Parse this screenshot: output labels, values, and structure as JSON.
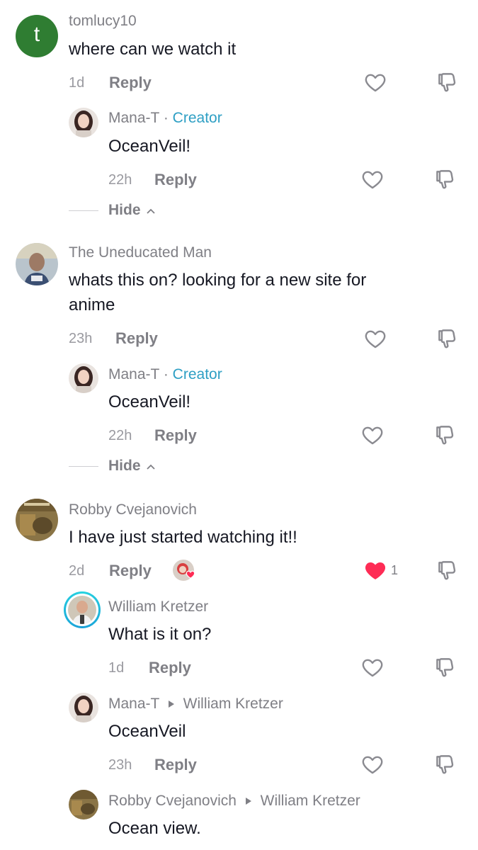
{
  "threads": [
    {
      "username": "tomlucy10",
      "avatar_letter": "t",
      "text": "where can we watch it",
      "time": "1d",
      "reply_label": "Reply",
      "replies": [
        {
          "username": "Mana-T",
          "dot": "·",
          "badge": "Creator",
          "text": "OceanVeil!",
          "time": "22h",
          "reply_label": "Reply"
        }
      ],
      "hide_label": "Hide"
    },
    {
      "username": "The Uneducated Man",
      "text_line1": "whats this on? looking for a new site for",
      "text_line2": "anime",
      "time": "23h",
      "reply_label": "Reply",
      "replies": [
        {
          "username": "Mana-T",
          "dot": "·",
          "badge": "Creator",
          "text": "OceanVeil!",
          "time": "22h",
          "reply_label": "Reply"
        }
      ],
      "hide_label": "Hide"
    },
    {
      "username": "Robby Cvejanovich",
      "text": "I have just started watching it!!",
      "time": "2d",
      "reply_label": "Reply",
      "like_count": "1",
      "replies": [
        {
          "username": "William Kretzer",
          "text": "What is it on?",
          "time": "1d",
          "reply_label": "Reply"
        },
        {
          "username": "Mana-T",
          "reply_to": "William Kretzer",
          "text": "OceanVeil",
          "time": "23h",
          "reply_label": "Reply"
        },
        {
          "username": "Robby Cvejanovich",
          "reply_to": "William Kretzer",
          "text": "Ocean view."
        }
      ]
    }
  ],
  "colors": {
    "accent": "#2e9fc4",
    "liked": "#fe2c55",
    "avatar_green": "#2f7d32"
  },
  "icons": {
    "like": "heart-outline-icon",
    "liked": "heart-filled-icon",
    "dislike": "thumbs-down-icon",
    "expand_up": "chevron-up-icon",
    "reply_arrow": "triangle-right-icon"
  }
}
